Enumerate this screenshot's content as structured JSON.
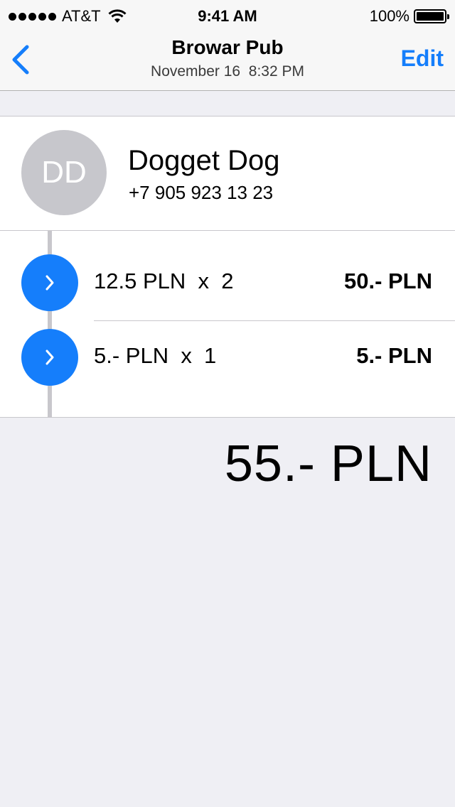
{
  "status_bar": {
    "carrier": "AT&T",
    "time": "9:41 AM",
    "battery": "100%"
  },
  "nav": {
    "title": "Browar Pub",
    "subtitle": "November 16  8:32 PM",
    "edit_label": "Edit",
    "back_icon": "chevron-left-icon"
  },
  "contact": {
    "initials": "DD",
    "name": "Dogget Dog",
    "phone": "+7 905 923 13 23"
  },
  "items": [
    {
      "description": "12.5 PLN  x  2",
      "total": "50.- PLN"
    },
    {
      "description": "5.- PLN  x  1",
      "total": "5.- PLN"
    }
  ],
  "grand_total": "55.- PLN",
  "colors": {
    "accent": "#157efb",
    "avatar_bg": "#c7c7cc",
    "background": "#efeff4"
  }
}
